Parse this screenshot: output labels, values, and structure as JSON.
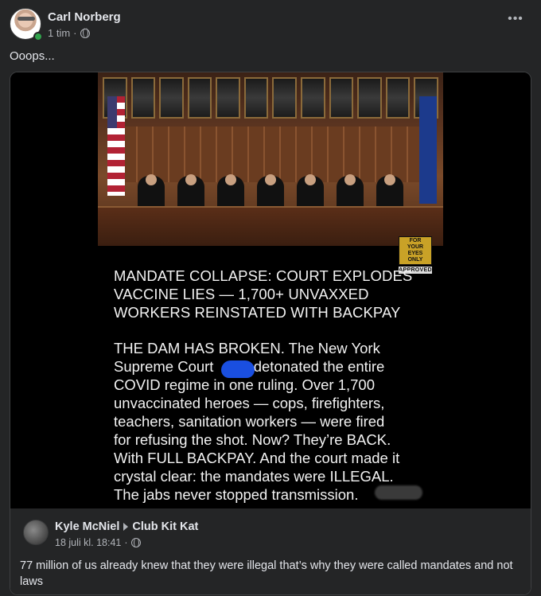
{
  "post": {
    "author": "Carl Norberg",
    "time": "1 tim",
    "separator": "·",
    "more_icon": "•••",
    "caption": "Ooops..."
  },
  "shared_image": {
    "stamp_top": "FOR YOUR EYES ONLY",
    "stamp_bottom": "APPROVED",
    "headline": "MANDATE COLLAPSE: COURT EXPLODES VACCINE LIES — 1,700+ UNVAXXED WORKERS REINSTATED WITH BACKPAY",
    "body": "THE DAM HAS BROKEN. The New York Supreme Court [redacted] detonated the entire COVID regime in one ruling. Over 1,700 unvaccinated heroes — cops, firefighters, teachers, sanitation workers — were fired for refusing the shot. Now? They’re BACK. With FULL BACKPAY. And the court made it crystal clear: the mandates were ILLEGAL. The jabs never stopped transmission.",
    "body_parts": {
      "line1": "THE DAM HAS BROKEN. The New York",
      "line2a": "Supreme Court ",
      "line2b": " detonated the entire",
      "line3": "COVID regime in one ruling. Over 1,700",
      "line4": "unvaccinated heroes — cops, firefighters,",
      "line5": "teachers, sanitation workers — were fired",
      "line6": "for refusing the shot. Now? They’re BACK.",
      "line7": "With FULL BACKPAY. And the court made it",
      "line8": "crystal clear: the mandates were ILLEGAL.",
      "line9": "The jabs never stopped transmission."
    },
    "headline_parts": {
      "line1": "MANDATE COLLAPSE: COURT EXPLODES",
      "line2": "VACCINE LIES — 1,700+ UNVAXXED",
      "line3": "WORKERS REINSTATED WITH BACKPAY"
    }
  },
  "original_post": {
    "author": "Kyle McNiel",
    "group": "Club Kit Kat",
    "time": "18 juli kl. 18:41",
    "separator": "·",
    "text": "77 million of us already knew that they were illegal that’s why they were called mandates and not laws"
  },
  "colors": {
    "background": "#242526",
    "text": "#e4e6eb",
    "secondary": "#b0b3b8",
    "online": "#31a24c"
  },
  "icons": [
    "globe-icon",
    "more-icon",
    "triangle-right-icon",
    "online-status-icon"
  ]
}
